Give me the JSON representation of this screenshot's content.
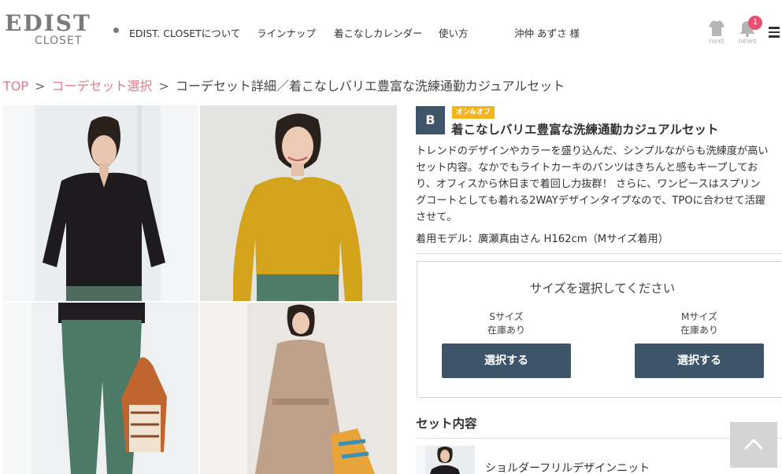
{
  "header": {
    "logo": {
      "main": "EDIST",
      "sub": "CLOSET"
    },
    "nav": [
      {
        "label": "EDIST. CLOSETについて"
      },
      {
        "label": "ラインナップ"
      },
      {
        "label": "着こなしカレンダー"
      },
      {
        "label": "使い方"
      }
    ],
    "user_name": "沖仲 あずさ 様",
    "icons": {
      "next_label": "next",
      "news_label": "news",
      "news_badge": "1"
    }
  },
  "breadcrumb": {
    "items": [
      "TOP",
      "コーデセット選択",
      "コーデセット詳細／着こなしバリエ豊富な洗練通勤カジュアルセット"
    ],
    "separator": ">"
  },
  "product": {
    "grade": "B",
    "tag": "オン&オフ",
    "title": "着こなしバリエ豊富な洗練通勤カジュアルセット",
    "description_lines": [
      "トレンドのデザインやカラーを盛り込んだ、シンプルながらも洗練度が高い",
      "セット内容。なかでもライトカーキのパンツはきちんと感もキープしてお",
      "り、オフィスから休日まで着回し力抜群！ さらに、ワンピースはスプリン",
      "グコートとしても着れる2WAYデザインタイプなので、TPOに合わせて活躍",
      "させて。"
    ],
    "model_note": "着用モデル：廣瀬真由さん H162cm（Mサイズ着用）"
  },
  "size_selector": {
    "title": "サイズを選択してください",
    "options": [
      {
        "name": "Sサイズ",
        "stock": "在庫あり",
        "button": "選択する"
      },
      {
        "name": "Mサイズ",
        "stock": "在庫あり",
        "button": "選択する"
      }
    ]
  },
  "set_contents": {
    "title": "セット内容",
    "items": [
      {
        "name": "ショルダーフリルデザインニット"
      }
    ]
  },
  "colors": {
    "navy": "#3e5468",
    "pink_link": "#e07a8a",
    "tag_yellow": "#f5b31e",
    "badge_red": "#e8506f"
  }
}
